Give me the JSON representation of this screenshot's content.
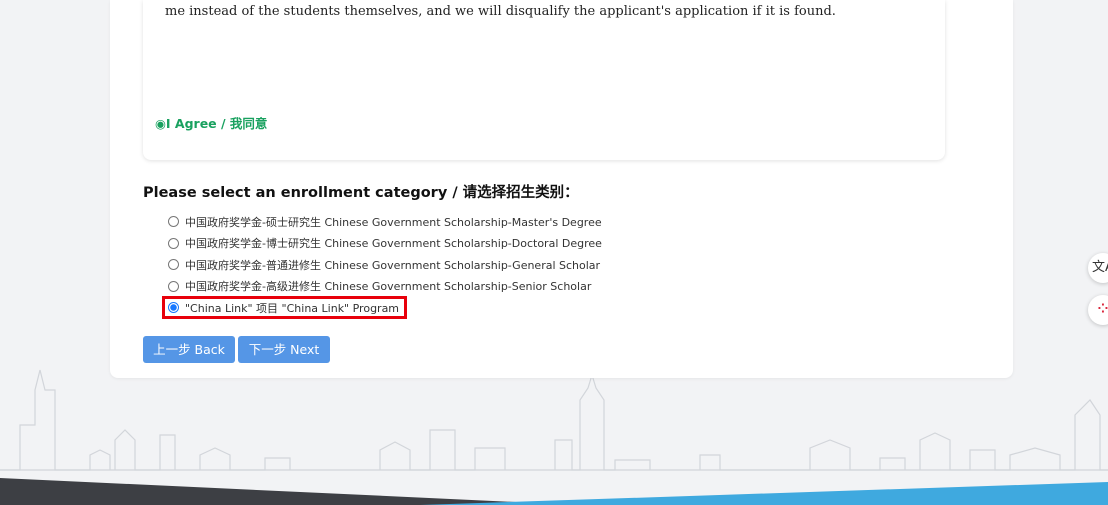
{
  "agreement": {
    "terms_text": "me instead of the students themselves, and we will disqualify the applicant's application if it is found.",
    "agree_label": "◉I Agree / 我同意"
  },
  "enrollment": {
    "title": "Please select an enrollment category / 请选择招生类别：",
    "options": [
      {
        "label": "中国政府奖学金-硕士研究生 Chinese Government Scholarship-Master's Degree",
        "selected": false
      },
      {
        "label": "中国政府奖学金-博士研究生 Chinese Government Scholarship-Doctoral Degree",
        "selected": false
      },
      {
        "label": "中国政府奖学金-普通进修生 Chinese Government Scholarship-General Scholar",
        "selected": false
      },
      {
        "label": "中国政府奖学金-高级进修生 Chinese Government Scholarship-Senior Scholar",
        "selected": false
      },
      {
        "label": "\"China Link\" 项目 \"China Link\" Program",
        "selected": true
      }
    ]
  },
  "buttons": {
    "back_label": "上一步 Back",
    "next_label": "下一步 Next"
  },
  "floating": {
    "translate_glyph": "文A",
    "share_glyph": "⁘"
  },
  "colors": {
    "accent": "#5596e6",
    "agree_green": "#19a15f",
    "highlight_red": "#e8000b",
    "radio_blue": "#1677ff"
  }
}
